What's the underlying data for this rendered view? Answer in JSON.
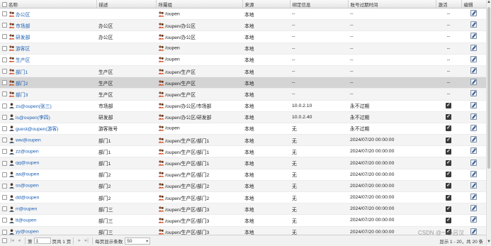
{
  "columns": {
    "name": "名称",
    "desc": "描述",
    "group": "所屬组",
    "source": "来源",
    "binding": "绑定信息",
    "expire": "账号过期时间",
    "active": "激活",
    "edit": "编辑"
  },
  "rows": [
    {
      "type": "group",
      "name": "办公区",
      "desc": "",
      "group": "/oupen",
      "source": "本地",
      "binding": "--",
      "expire": "--",
      "active": "--"
    },
    {
      "type": "group",
      "name": "市场部",
      "desc": "办公区",
      "group": "/oupen/办公区",
      "source": "本地",
      "binding": "--",
      "expire": "--",
      "active": "--"
    },
    {
      "type": "group",
      "name": "研发部",
      "desc": "办公区",
      "group": "/oupen/办公区",
      "source": "本地",
      "binding": "--",
      "expire": "--",
      "active": "--"
    },
    {
      "type": "group",
      "name": "游客区",
      "desc": "",
      "group": "/oupen",
      "source": "本地",
      "binding": "--",
      "expire": "--",
      "active": "--"
    },
    {
      "type": "group",
      "name": "生产区",
      "desc": "",
      "group": "/oupen",
      "source": "本地",
      "binding": "--",
      "expire": "--",
      "active": "--"
    },
    {
      "type": "group",
      "name": "部门1",
      "desc": "生产区",
      "group": "/oupen/生产区",
      "source": "本地",
      "binding": "--",
      "expire": "--",
      "active": "--"
    },
    {
      "type": "group",
      "name": "部门2",
      "desc": "生产区",
      "group": "/oupen/生产区",
      "source": "本地",
      "binding": "--",
      "expire": "--",
      "active": "--"
    },
    {
      "type": "group",
      "name": "部门3",
      "desc": "生产区",
      "group": "/oupen/生产区",
      "source": "本地",
      "binding": "--",
      "expire": "--",
      "active": "--"
    },
    {
      "type": "user",
      "name": "zs@oupen(张三)",
      "desc": "市场部",
      "group": "/oupen/办公区/市场部",
      "source": "本地",
      "binding": "10.0.2.10",
      "expire": "永不过期",
      "active": "✓"
    },
    {
      "type": "user",
      "name": "ls@oupen(李四)",
      "desc": "研发部",
      "group": "/oupen/办公区/研发部",
      "source": "本地",
      "binding": "10.0.2.40",
      "expire": "永不过期",
      "active": "✓"
    },
    {
      "type": "user",
      "name": "guest@oupen(游客)",
      "desc": "游客账号",
      "group": "/oupen",
      "source": "本地",
      "binding": "无",
      "expire": "永不过期",
      "active": "✓"
    },
    {
      "type": "user",
      "name": "ww@oupen",
      "desc": "部门1",
      "group": "/oupen/生产区/部门1",
      "source": "本地",
      "binding": "无",
      "expire": "2024/07/20 00:00:00",
      "active": "✓"
    },
    {
      "type": "user",
      "name": "zz@oupen",
      "desc": "部门1",
      "group": "/oupen/生产区/部门1",
      "source": "本地",
      "binding": "无",
      "expire": "2024/07/20 00:00:00",
      "active": "✓"
    },
    {
      "type": "user",
      "name": "qq@oupen",
      "desc": "部门1",
      "group": "/oupen/生产区/部门1",
      "source": "本地",
      "binding": "无",
      "expire": "2024/07/20 00:00:00",
      "active": "✓"
    },
    {
      "type": "user",
      "name": "aa@oupen",
      "desc": "部门2",
      "group": "/oupen/生产区/部门2",
      "source": "本地",
      "binding": "无",
      "expire": "2024/07/20 00:00:00",
      "active": "✓"
    },
    {
      "type": "user",
      "name": "ss@oupen",
      "desc": "部门2",
      "group": "/oupen/生产区/部门2",
      "source": "本地",
      "binding": "无",
      "expire": "2024/07/20 00:00:00",
      "active": "✓"
    },
    {
      "type": "user",
      "name": "dd@oupen",
      "desc": "部门2",
      "group": "/oupen/生产区/部门2",
      "source": "本地",
      "binding": "无",
      "expire": "2024/07/20 00:00:00",
      "active": "✓"
    },
    {
      "type": "user",
      "name": "rr@oupen",
      "desc": "部门三",
      "group": "/oupen/生产区/部门3",
      "source": "本地",
      "binding": "无",
      "expire": "2024/07/20 00:00:00",
      "active": "✓"
    },
    {
      "type": "user",
      "name": "tt@oupen",
      "desc": "部门三",
      "group": "/oupen/生产区/部门3",
      "source": "本地",
      "binding": "无",
      "expire": "2024/07/20 00:00:00",
      "active": "✓"
    },
    {
      "type": "user",
      "name": "yy@oupen",
      "desc": "部门三",
      "group": "/oupen/生产区/部门3",
      "source": "本地",
      "binding": "无",
      "expire": "2024/07/20 00:00:00",
      "active": "✓"
    }
  ],
  "selected_row": 6,
  "pager": {
    "page_prefix": "第",
    "page_value": "1",
    "page_suffix": "页共 1 页",
    "per_page_label": "每页显示条数",
    "per_page_value": "50",
    "info": "显示 1 - 20，共 20 条"
  },
  "watermark": "CSDN @一小吕汉",
  "icons": {
    "group": "user-group-icon",
    "user": "user-icon",
    "edit": "edit-icon"
  },
  "colors": {
    "link": "#1a5fb4",
    "selected_row": "#d4d4d4",
    "header_bg": "#ececec"
  }
}
